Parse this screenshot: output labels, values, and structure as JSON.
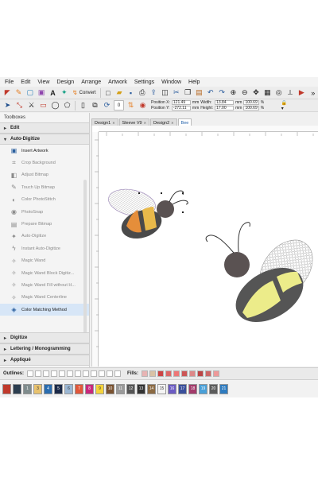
{
  "menu": [
    "File",
    "Edit",
    "View",
    "Design",
    "Arrange",
    "Artwork",
    "Settings",
    "Window",
    "Help"
  ],
  "toolbar": {
    "convert_label": "Convert",
    "zoom_value": "0"
  },
  "position": {
    "x_label": "Position X:",
    "x_value": "121.49",
    "x_unit": "mm",
    "y_label": "Position Y:",
    "y_value": "-272.11",
    "y_unit": "mm",
    "width_label": "Width:",
    "width_value": "13.84",
    "width_unit": "mm",
    "height_label": "Height:",
    "height_value": "17.00",
    "height_unit": "mm",
    "scale_w": "100.69",
    "scale_h": "100.69",
    "pct": "%"
  },
  "toolboxes": {
    "title": "Toolboxes",
    "sections": {
      "edit": "Edit",
      "auto_digitize": "Auto-Digitize",
      "digitize": "Digitize",
      "lettering": "Lettering / Monogramming",
      "applique": "Appliqué"
    },
    "tools": [
      {
        "label": "Insert Artwork",
        "icon": "insert-artwork-icon",
        "enabled": true
      },
      {
        "label": "Crop Background",
        "icon": "crop-icon",
        "enabled": false
      },
      {
        "label": "Adjust Bitmap",
        "icon": "adjust-bitmap-icon",
        "enabled": false
      },
      {
        "label": "Touch Up Bitmap",
        "icon": "pencil-icon",
        "enabled": false
      },
      {
        "label": "Color PhotoStitch",
        "icon": "photostitch-icon",
        "enabled": false
      },
      {
        "label": "PhotoSnap",
        "icon": "photosnap-icon",
        "enabled": false
      },
      {
        "label": "Prepare Bitmap",
        "icon": "prepare-bitmap-icon",
        "enabled": false
      },
      {
        "label": "Auto-Digitize",
        "icon": "auto-digitize-icon",
        "enabled": false
      },
      {
        "label": "Instant Auto-Digitize",
        "icon": "lightning-icon",
        "enabled": false
      },
      {
        "label": "Magic Wand",
        "icon": "magic-wand-icon",
        "enabled": false
      },
      {
        "label": "Magic Wand Block Digitiz...",
        "icon": "magic-wand-block-icon",
        "enabled": false
      },
      {
        "label": "Magic Wand Fill without H...",
        "icon": "magic-wand-fill-icon",
        "enabled": false
      },
      {
        "label": "Magic Wand Centerline",
        "icon": "magic-wand-centerline-icon",
        "enabled": false
      },
      {
        "label": "Color Matching Method",
        "icon": "color-matching-icon",
        "enabled": true
      }
    ]
  },
  "tabs": [
    {
      "label": "Design1",
      "active": false
    },
    {
      "label": "Sleeve V9",
      "active": false
    },
    {
      "label": "Design2",
      "active": false
    },
    {
      "label": "Bee",
      "active": true
    }
  ],
  "bottom": {
    "outlines_label": "Outlines:",
    "fills_label": "Fills:",
    "colors": [
      {
        "n": "",
        "c": "#c0392b"
      },
      {
        "n": "",
        "c": "#2c3e50"
      },
      {
        "n": "1",
        "c": "#7f8c8d"
      },
      {
        "n": "3",
        "c": "#e8c26e"
      },
      {
        "n": "4",
        "c": "#2a6db0"
      },
      {
        "n": "5",
        "c": "#1b2a48"
      },
      {
        "n": "6",
        "c": "#9bb7d4"
      },
      {
        "n": "7",
        "c": "#e1573a"
      },
      {
        "n": "8",
        "c": "#c8287c"
      },
      {
        "n": "9",
        "c": "#f5d33c"
      },
      {
        "n": "10",
        "c": "#7a5230"
      },
      {
        "n": "11",
        "c": "#9a9a9a"
      },
      {
        "n": "12",
        "c": "#555555"
      },
      {
        "n": "13",
        "c": "#333333"
      },
      {
        "n": "14",
        "c": "#8b6a43"
      },
      {
        "n": "15",
        "c": "#f4f4f4"
      },
      {
        "n": "16",
        "c": "#6b5bc3"
      },
      {
        "n": "17",
        "c": "#3a4f9b"
      },
      {
        "n": "18",
        "c": "#a33b6b"
      },
      {
        "n": "19",
        "c": "#4aa0d8"
      },
      {
        "n": "20",
        "c": "#5c5c5c"
      },
      {
        "n": "21",
        "c": "#2e7bbf"
      }
    ]
  }
}
